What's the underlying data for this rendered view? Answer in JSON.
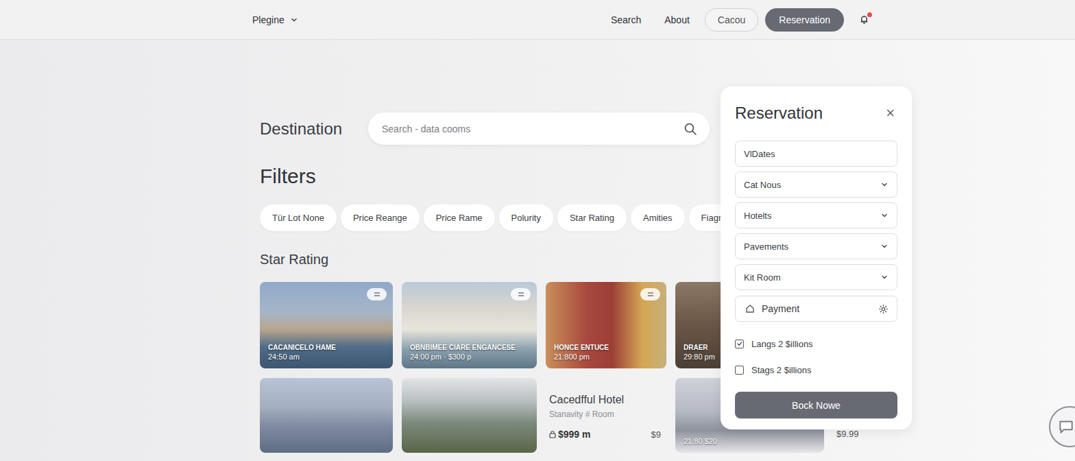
{
  "nav": {
    "brand": "Plegine",
    "items": [
      {
        "label": "Search",
        "kind": "link"
      },
      {
        "label": "About",
        "kind": "link"
      },
      {
        "label": "Cacou",
        "kind": "outline"
      },
      {
        "label": "Reservation",
        "kind": "primary"
      }
    ],
    "notification": true
  },
  "destination": {
    "label": "Destination",
    "placeholder": "Search - data cooms"
  },
  "filters": {
    "title": "Filters",
    "chips": [
      "Tür Lot None",
      "Price Reange",
      "Price Rame",
      "Polurity",
      "Star Rating",
      "Amities",
      "Fiagment"
    ]
  },
  "section": {
    "title": "Star Rating"
  },
  "cards": [
    [
      {
        "kind": "photo",
        "title": "CACANICELO HAME",
        "subtitle": "24:50 am",
        "badge": true
      },
      {
        "kind": "photo",
        "title": "OBNBIMEE CIARE ENGANCESE",
        "subtitle": "24:00 pm · $300 p",
        "badge": true
      },
      {
        "kind": "photo",
        "title": "HONCE ENTUCE",
        "subtitle": "21:800 pm",
        "badge": true
      },
      {
        "kind": "photo",
        "title": "DRAER",
        "subtitle": "29:80 pm",
        "badge": false
      }
    ],
    [
      {
        "kind": "photo",
        "badge": false
      },
      {
        "kind": "photo",
        "badge": false
      },
      {
        "kind": "info",
        "title": "Cacedfful Hotel",
        "subtitle": "Stanavity # Room",
        "price": "$999 m",
        "price_alt": "$9"
      },
      {
        "kind": "photo",
        "subtitle": "21:80 $20",
        "badge": false
      }
    ]
  ],
  "trailing_price": "$9.99",
  "reservation": {
    "title": "Reservation",
    "close": "×",
    "fields": [
      {
        "label": "VlDates",
        "kind": "text"
      },
      {
        "label": "Cat Nous",
        "kind": "select"
      },
      {
        "label": "Hotelts",
        "kind": "select"
      },
      {
        "label": "Pavements",
        "kind": "select"
      },
      {
        "label": "Kit Room",
        "kind": "select"
      },
      {
        "label": "Payment",
        "kind": "payment"
      }
    ],
    "options": [
      {
        "label": "Langs 2 $illions",
        "checked": true
      },
      {
        "label": "Stags 2 $illions",
        "checked": false
      }
    ],
    "button": "Bock Nowe"
  }
}
